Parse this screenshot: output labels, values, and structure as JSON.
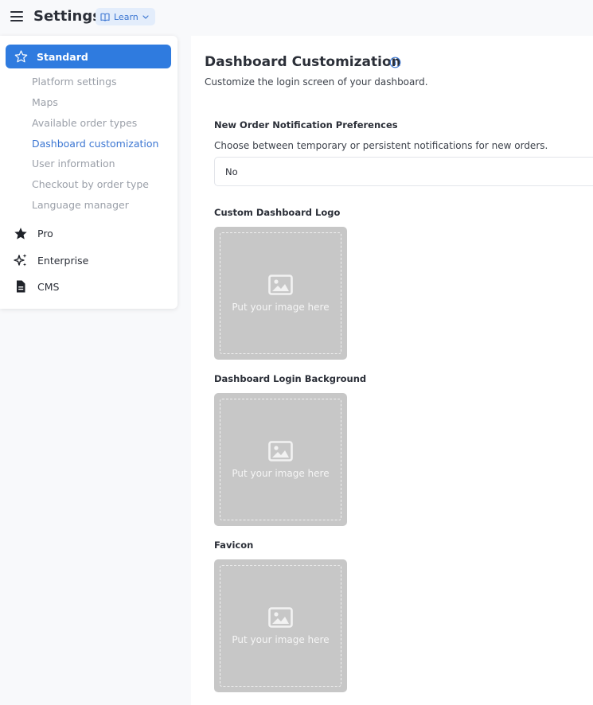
{
  "header": {
    "title": "Settings",
    "learn_label": "Learn"
  },
  "sidebar": {
    "active_item": "Standard",
    "sub_items": [
      "Platform settings",
      "Maps",
      "Available order types",
      "Dashboard customization",
      "User information",
      "Checkout by order type",
      "Language manager"
    ],
    "current_sub_item": "Dashboard customization",
    "items": [
      "Pro",
      "Enterprise",
      "CMS"
    ]
  },
  "main": {
    "title": "Dashboard Customization",
    "subtitle": "Customize the login screen of your dashboard.",
    "notification": {
      "label": "New Order Notification Preferences",
      "description": "Choose between temporary or persistent notifications for new orders.",
      "value": "No"
    },
    "uploads": [
      {
        "label": "Custom Dashboard Logo",
        "placeholder": "Put your image here"
      },
      {
        "label": "Dashboard Login Background",
        "placeholder": "Put your image here"
      },
      {
        "label": "Favicon",
        "placeholder": "Put your image here"
      }
    ]
  },
  "icons": {
    "menu": "hamburger-menu-icon",
    "learn": "book-icon",
    "learn_chevron": "chevron-down-icon",
    "standard": "star-outline-icon",
    "pro": "star-filled-icon",
    "enterprise": "sparkles-icon",
    "cms": "document-icon",
    "info": "info-circle-icon",
    "upload": "image-icon"
  },
  "colors": {
    "accent": "#2f7bdf",
    "link": "#3b76d2",
    "upload_bg": "#c7c7c7"
  }
}
